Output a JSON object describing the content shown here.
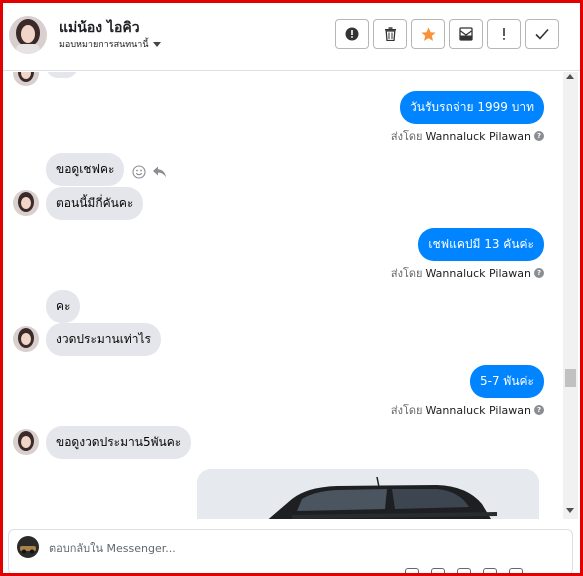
{
  "header": {
    "contact_name": "แม่น้อง ไอคิว",
    "assign_label": "มอบหมายการสนทนานี้",
    "actions": [
      {
        "icon": "alert-circle-icon"
      },
      {
        "icon": "trash-icon"
      },
      {
        "icon": "star-icon",
        "color": "#f7923b"
      },
      {
        "icon": "mail-icon"
      },
      {
        "icon": "exclamation-icon",
        "label": "!"
      },
      {
        "icon": "check-icon"
      }
    ]
  },
  "thread": {
    "messages": [
      {
        "dir": "out",
        "text": "วันรับรถจ่าย 1999 บาท",
        "sent_by_prefix": "ส่งโดย",
        "sent_by_name": "Wannaluck Pilawan"
      },
      {
        "dir": "in",
        "text": "ขอดูเชฟคะ"
      },
      {
        "dir": "in",
        "text": "ตอนนี้มีกี่คันคะ"
      },
      {
        "dir": "out",
        "text": "เชฟแคปมี 13 คันค่ะ",
        "sent_by_prefix": "ส่งโดย",
        "sent_by_name": "Wannaluck Pilawan"
      },
      {
        "dir": "in",
        "text": "คะ"
      },
      {
        "dir": "in",
        "text": "งวดประมานเท่าไร"
      },
      {
        "dir": "out",
        "text": "5-7 พันค่ะ",
        "sent_by_prefix": "ส่งโดย",
        "sent_by_name": "Wannaluck Pilawan"
      },
      {
        "dir": "in",
        "text": "ขอดูงวดประมาน5พันคะ"
      }
    ]
  },
  "composer": {
    "placeholder": "ตอบกลับใน Messenger..."
  },
  "colors": {
    "accent": "#0084ff",
    "incoming_bubble": "#e4e6eb",
    "frame_border": "#e00000"
  }
}
